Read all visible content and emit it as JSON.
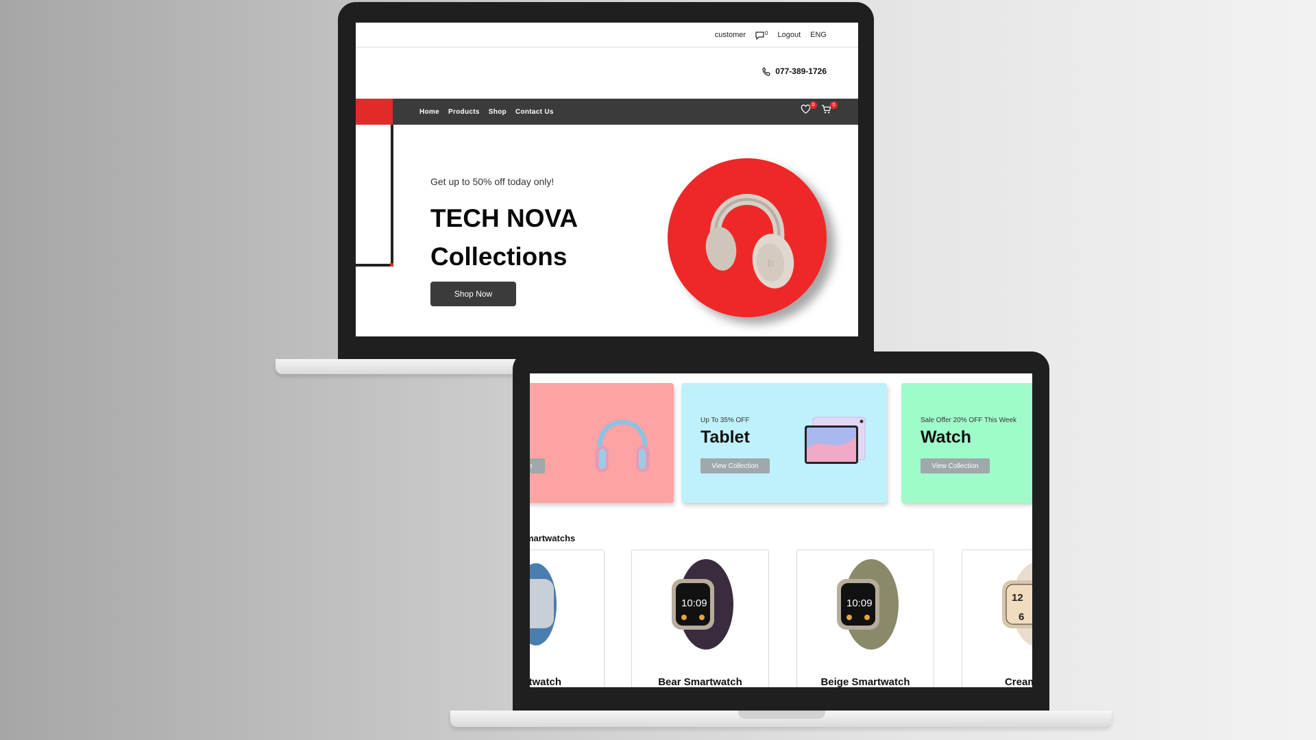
{
  "back_screen": {
    "util_bar": {
      "customer": "customer",
      "messages_count": "0",
      "logout": "Logout",
      "language": "ENG"
    },
    "phone": "077-389-1726",
    "nav": {
      "items": [
        "Home",
        "Products",
        "Shop",
        "Contact Us"
      ],
      "wishlist_count": "0",
      "cart_count": "0"
    },
    "hero": {
      "subtitle": "Get up to 50% off today only!",
      "title_line1": "TECH NOVA",
      "title_line2": "Collections",
      "button": "Shop Now"
    }
  },
  "front_screen": {
    "categories": [
      {
        "offer": "",
        "name": "",
        "button": "ion",
        "bg": "#fea3a3"
      },
      {
        "offer": "Up To 35% OFF",
        "name": "Tablet",
        "button": "View Collection",
        "bg": "#bef1fb"
      },
      {
        "offer": "Sale Offer 20% OFF This Week",
        "name": "Watch",
        "button": "View Collection",
        "bg": "#a0fbcb"
      }
    ],
    "section_title": "martwatchs",
    "products": [
      {
        "name": "martwatch",
        "band_color": "#4a7db0"
      },
      {
        "name": "Bear Smartwatch",
        "band_color": "#3a2c3e"
      },
      {
        "name": "Beige Smartwatch",
        "band_color": "#8a8a6a"
      },
      {
        "name": "Creamy Sr",
        "band_color": "#e8ddd0"
      }
    ]
  },
  "colors": {
    "accent_red": "#e32a2a",
    "nav_dark": "#3b3b3b"
  }
}
